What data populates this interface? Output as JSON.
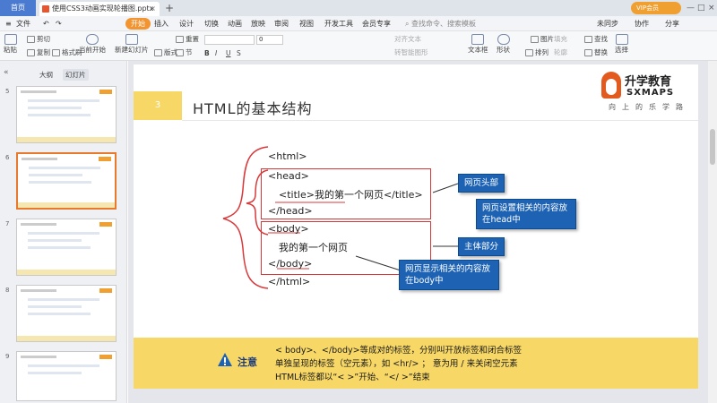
{
  "titlebar": {
    "home_tab": "首页",
    "doc_tab": "使用CSS3动画实现轮播图.pptx",
    "user": "VIP会员",
    "colors": {
      "bg": "#dfe3ea",
      "home": "#4a7bd0"
    }
  },
  "ribbon_tabs": [
    "文件",
    "开始",
    "插入",
    "设计",
    "切换",
    "动画",
    "放映",
    "审阅",
    "视图",
    "开发工具",
    "会员专享"
  ],
  "ribbon_search": "查找命令、搜索模板",
  "ribbon_right": [
    "未同步",
    "协作",
    "分享"
  ],
  "toolbar": {
    "paste": "粘贴",
    "cut": "剪切",
    "copy": "复制",
    "format_painter": "格式刷",
    "from_current": "当前开始",
    "new_slide": "新建幻灯片",
    "layout": "版式",
    "section": "节",
    "reset": "重置",
    "font_size": "0",
    "text_box": "文本框",
    "shape": "形状",
    "arrange": "排列",
    "outline": "轮廓",
    "picture": "图片",
    "fill": "填充",
    "find": "查找",
    "replace": "替换",
    "select": "选择",
    "align_text": "对齐文本",
    "smartart": "转智能图形"
  },
  "left_panel": {
    "tab_outline": "大纲",
    "tab_slides": "幻灯片",
    "slide_numbers": [
      "5",
      "6",
      "7",
      "8",
      "9"
    ],
    "selected_index": 1
  },
  "slide": {
    "number": "3",
    "title": "HTML的基本结构",
    "logo_cn": "升学教育",
    "logo_en": "SXMAPS",
    "tagline": "向上的乐学路",
    "code_lines": [
      "<html>",
      "<head>",
      "<title>我的第一个网页</title>",
      "</head>",
      "<body>",
      "我的第一个网页",
      "</body>",
      "</html>"
    ],
    "callouts": {
      "head_label": "网页头部",
      "head_desc": "网页设置相关的内容放在head中",
      "body_label": "主体部分",
      "body_desc": "网页显示相关的内容放在body中"
    },
    "note_label": "注意",
    "notes": [
      "< body>、</body>等成对的标签，分别叫开放标签和闭合标签",
      "单独呈现的标签（空元素），如 <hr/> ； 意为用 / 来关闭空元素",
      "HTML标签都以“< >”开始、“</ >”结束"
    ],
    "colors": {
      "accent": "#f7d766",
      "callout": "#1e63b3",
      "box": "#d9383a",
      "brace": "#d9383a"
    }
  }
}
